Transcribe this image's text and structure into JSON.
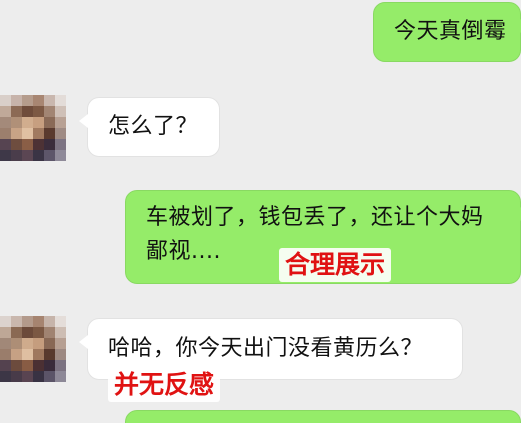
{
  "messages": [
    {
      "side": "out",
      "text": "今天真倒霉"
    },
    {
      "side": "in",
      "text": "怎么了？"
    },
    {
      "side": "out",
      "text": "车被划了，钱包丢了，还让个大妈\n鄙视...."
    },
    {
      "side": "in",
      "text": "哈哈，你今天出门没看黄历么？"
    },
    {
      "side": "out",
      "text": ""
    }
  ],
  "annotations": {
    "reasonable_display": "合理展示",
    "no_dislike": "并无反感"
  },
  "colors": {
    "background": "#ededed",
    "outgoing_bubble": "#95ec69",
    "incoming_bubble": "#ffffff",
    "annotation_red": "#e01212"
  },
  "icons": {
    "avatar": "pixelated-avatar"
  }
}
